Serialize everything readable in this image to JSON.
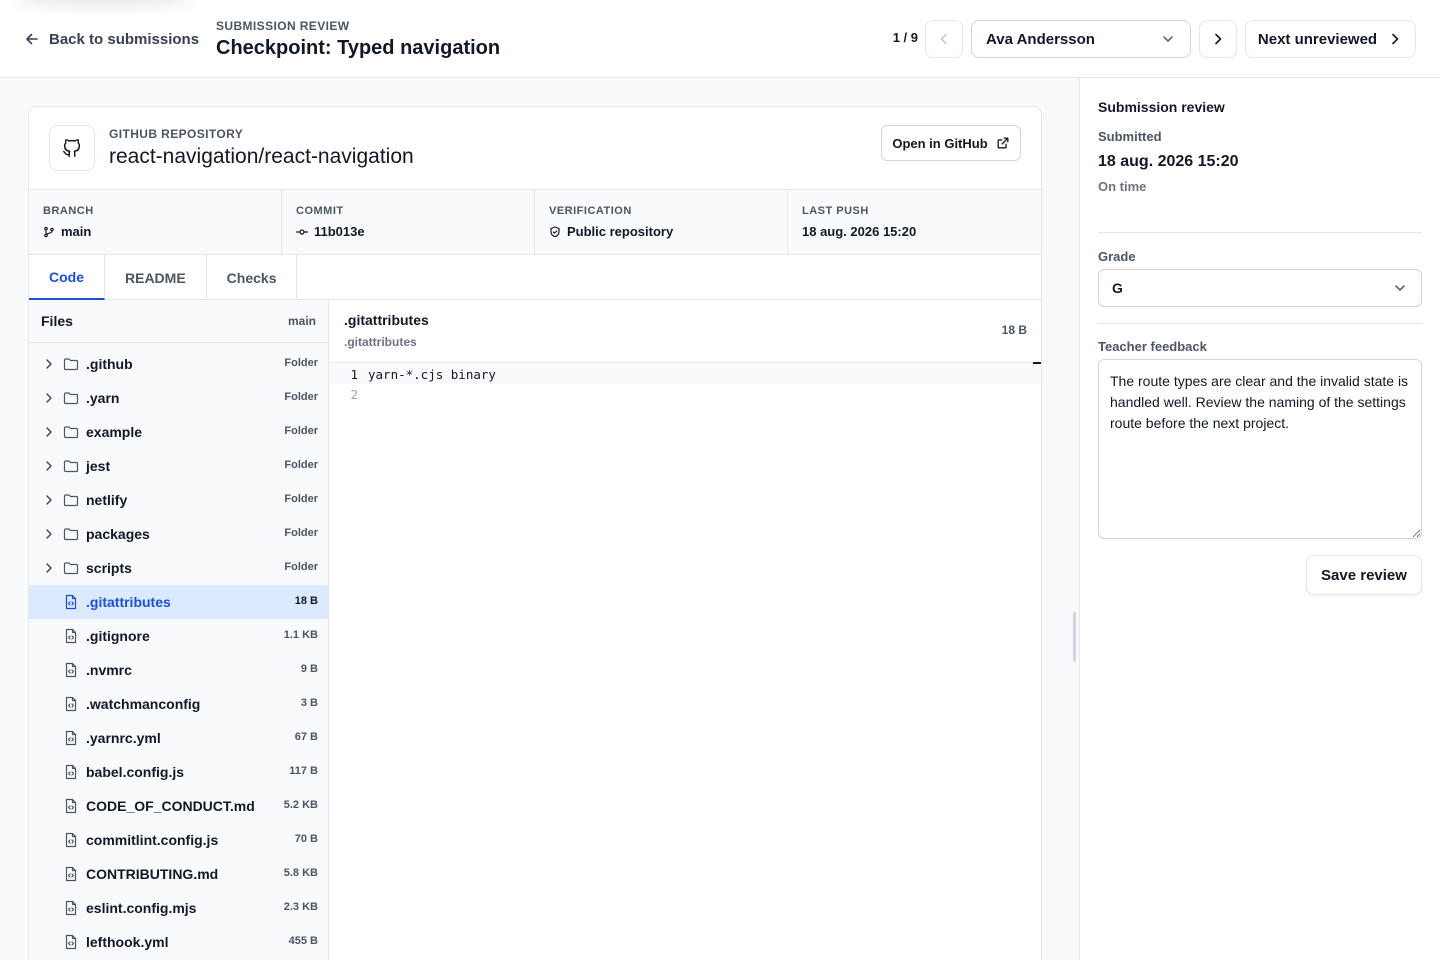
{
  "header": {
    "back_label": "Back to submissions",
    "eyebrow": "SUBMISSION REVIEW",
    "title": "Checkpoint: Typed navigation",
    "counter": "1 / 9",
    "student": "Ava Andersson",
    "next_unreviewed_label": "Next unreviewed"
  },
  "repo": {
    "label": "GITHUB REPOSITORY",
    "name": "react-navigation/react-navigation",
    "open_label": "Open in GitHub",
    "meta": [
      {
        "label": "BRANCH",
        "value": "main",
        "icon": "branch-icon"
      },
      {
        "label": "COMMIT",
        "value": "11b013e",
        "icon": "commit-icon"
      },
      {
        "label": "VERIFICATION",
        "value": "Public repository",
        "icon": "shield-icon"
      },
      {
        "label": "LAST PUSH",
        "value": "18 aug. 2026 15:20"
      }
    ],
    "tabs": [
      {
        "label": "Code",
        "active": true
      },
      {
        "label": "README",
        "active": false
      },
      {
        "label": "Checks",
        "active": false
      }
    ]
  },
  "files": {
    "title": "Files",
    "branch": "main",
    "items": [
      {
        "name": ".github",
        "type": "folder",
        "size": "Folder"
      },
      {
        "name": ".yarn",
        "type": "folder",
        "size": "Folder"
      },
      {
        "name": "example",
        "type": "folder",
        "size": "Folder"
      },
      {
        "name": "jest",
        "type": "folder",
        "size": "Folder"
      },
      {
        "name": "netlify",
        "type": "folder",
        "size": "Folder"
      },
      {
        "name": "packages",
        "type": "folder",
        "size": "Folder"
      },
      {
        "name": "scripts",
        "type": "folder",
        "size": "Folder"
      },
      {
        "name": ".gitattributes",
        "type": "file",
        "size": "18 B",
        "selected": true
      },
      {
        "name": ".gitignore",
        "type": "file",
        "size": "1.1 KB"
      },
      {
        "name": ".nvmrc",
        "type": "file",
        "size": "9 B"
      },
      {
        "name": ".watchmanconfig",
        "type": "file",
        "size": "3 B"
      },
      {
        "name": ".yarnrc.yml",
        "type": "file",
        "size": "67 B"
      },
      {
        "name": "babel.config.js",
        "type": "file",
        "size": "117 B"
      },
      {
        "name": "CODE_OF_CONDUCT.md",
        "type": "file",
        "size": "5.2 KB"
      },
      {
        "name": "commitlint.config.js",
        "type": "file",
        "size": "70 B"
      },
      {
        "name": "CONTRIBUTING.md",
        "type": "file",
        "size": "5.8 KB"
      },
      {
        "name": "eslint.config.mjs",
        "type": "file",
        "size": "2.3 KB"
      },
      {
        "name": "lefthook.yml",
        "type": "file",
        "size": "455 B"
      }
    ]
  },
  "editor": {
    "file_name": ".gitattributes",
    "path": ".gitattributes",
    "size": "18 B",
    "lines": [
      {
        "num": "1",
        "text": "yarn-*.cjs binary"
      },
      {
        "num": "2",
        "text": ""
      }
    ]
  },
  "review": {
    "title": "Submission review",
    "submitted_label": "Submitted",
    "submitted_date": "18 aug. 2026 15:20",
    "status": "On time",
    "grade_label": "Grade",
    "grade_value": "G",
    "feedback_label": "Teacher feedback",
    "feedback_text": "The route types are clear and the invalid state is handled well. Review the naming of the settings route before the next project.",
    "save_label": "Save review"
  },
  "colors": {
    "accent": "#1d4ed8",
    "selected_row": "#dbeafe",
    "border": "#e5e7eb",
    "muted_bg": "#f9fafb"
  }
}
